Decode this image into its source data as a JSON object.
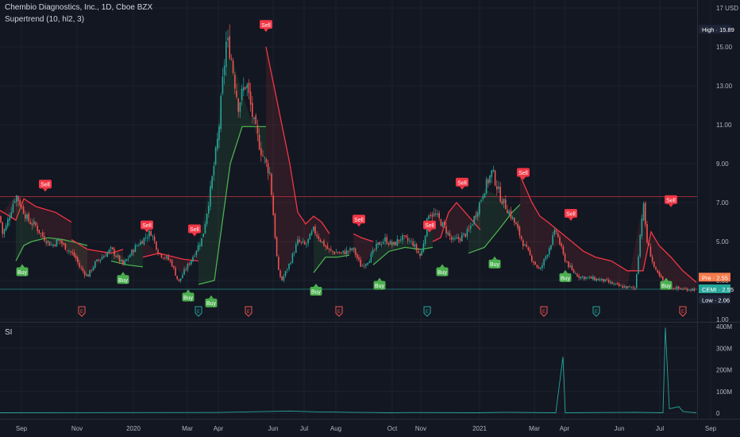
{
  "header": {
    "symbol_line": "Chembio Diagnostics, Inc., 1D, Cboe BZX",
    "indicator_line": "Supertrend (10, hl2, 3)"
  },
  "si_panel": {
    "title": "SI"
  },
  "colors": {
    "background": "#131722",
    "up_candle": "#26a69a",
    "down_candle": "#ef5350",
    "supertrend_up": "#4caf50",
    "supertrend_down": "#f23645",
    "grid": "#1e222d",
    "axis_text": "#b2b5be"
  },
  "tags": {
    "high": "High · 15.89",
    "pre": "Pre · 2.55",
    "cemi": "CEMI · 2.55",
    "low": "Low · 2.06"
  },
  "chart_data": [
    {
      "type": "candlestick",
      "title": "Chembio Diagnostics, Inc., 1D, Cboe BZX",
      "y_unit": "USD",
      "y_ticks": [
        "1.00",
        "3.00",
        "5.00",
        "7.00",
        "9.00",
        "11.00",
        "13.00",
        "15.00",
        "17 USD"
      ],
      "y_tick_values": [
        1,
        3,
        5,
        7,
        9,
        11,
        13,
        15,
        17
      ],
      "ylim": [
        1,
        17
      ],
      "x_ticks": [
        "Sep",
        "Nov",
        "2020",
        "Mar",
        "Apr",
        "Jun",
        "Jul",
        "Aug",
        "Oct",
        "Nov",
        "2021",
        "Mar",
        "Apr",
        "Jun",
        "Jul",
        "Sep"
      ],
      "price_path": [
        [
          0,
          6.3
        ],
        [
          3,
          5.4
        ],
        [
          8,
          5.8
        ],
        [
          15,
          6.8
        ],
        [
          20,
          7.4
        ],
        [
          25,
          7.0
        ],
        [
          35,
          6.1
        ],
        [
          45,
          5.8
        ],
        [
          55,
          5.2
        ],
        [
          65,
          4.8
        ],
        [
          75,
          5.1
        ],
        [
          80,
          4.8
        ],
        [
          95,
          4.2
        ],
        [
          100,
          3.7
        ],
        [
          110,
          3.2
        ],
        [
          120,
          3.9
        ],
        [
          140,
          4.6
        ],
        [
          155,
          3.8
        ],
        [
          170,
          4.7
        ],
        [
          190,
          5.5
        ],
        [
          200,
          4.4
        ],
        [
          215,
          4.0
        ],
        [
          225,
          2.9
        ],
        [
          231,
          3.4
        ],
        [
          240,
          4.0
        ],
        [
          255,
          5.2
        ],
        [
          265,
          7.6
        ],
        [
          275,
          10.5
        ],
        [
          280,
          13.0
        ],
        [
          285,
          15.3
        ],
        [
          290,
          14.8
        ],
        [
          300,
          12.0
        ],
        [
          310,
          13.2
        ],
        [
          320,
          11.0
        ],
        [
          330,
          9.5
        ],
        [
          340,
          8.5
        ],
        [
          350,
          3.5
        ],
        [
          355,
          3.0
        ],
        [
          365,
          3.9
        ],
        [
          375,
          5.0
        ],
        [
          385,
          4.8
        ],
        [
          395,
          5.6
        ],
        [
          405,
          5.0
        ],
        [
          415,
          4.5
        ],
        [
          430,
          4.4
        ],
        [
          445,
          4.6
        ],
        [
          455,
          3.7
        ],
        [
          465,
          4.1
        ],
        [
          475,
          4.8
        ],
        [
          485,
          5.1
        ],
        [
          495,
          4.8
        ],
        [
          505,
          5.2
        ],
        [
          520,
          4.9
        ],
        [
          530,
          4.2
        ],
        [
          540,
          6.5
        ],
        [
          550,
          6.3
        ],
        [
          560,
          5.7
        ],
        [
          570,
          5.0
        ],
        [
          580,
          5.2
        ],
        [
          590,
          5.5
        ],
        [
          600,
          6.5
        ],
        [
          610,
          7.7
        ],
        [
          620,
          8.6
        ],
        [
          630,
          7.3
        ],
        [
          640,
          6.6
        ],
        [
          650,
          5.8
        ],
        [
          660,
          4.8
        ],
        [
          670,
          4.1
        ],
        [
          680,
          3.5
        ],
        [
          690,
          4.5
        ],
        [
          700,
          5.6
        ],
        [
          710,
          4.2
        ],
        [
          720,
          3.5
        ],
        [
          730,
          3.2
        ],
        [
          745,
          3.1
        ],
        [
          760,
          3.0
        ],
        [
          780,
          2.7
        ],
        [
          800,
          2.6
        ],
        [
          810,
          7.0
        ],
        [
          815,
          5.0
        ],
        [
          825,
          3.5
        ],
        [
          840,
          2.7
        ],
        [
          860,
          2.55
        ],
        [
          877,
          2.55
        ]
      ],
      "supertrend": [
        {
          "direction": "down",
          "points": [
            [
              0,
              6.6
            ],
            [
              20,
              6.1
            ],
            [
              30,
              7.2
            ],
            [
              45,
              6.8
            ],
            [
              70,
              6.5
            ],
            [
              90,
              6.0
            ]
          ]
        },
        {
          "direction": "up",
          "points": [
            [
              20,
              4.0
            ],
            [
              30,
              4.8
            ],
            [
              40,
              5.0
            ],
            [
              60,
              5.2
            ],
            [
              80,
              5.1
            ],
            [
              90,
              5.0
            ],
            [
              110,
              4.8
            ]
          ]
        },
        {
          "direction": "down",
          "points": [
            [
              90,
              5.1
            ],
            [
              110,
              4.6
            ],
            [
              140,
              4.4
            ],
            [
              155,
              4.6
            ]
          ]
        },
        {
          "direction": "up",
          "points": [
            [
              140,
              4.0
            ],
            [
              160,
              3.8
            ],
            [
              180,
              3.7
            ]
          ]
        },
        {
          "direction": "down",
          "points": [
            [
              180,
              4.2
            ],
            [
              200,
              4.4
            ],
            [
              230,
              4.1
            ],
            [
              250,
              4.0
            ]
          ]
        },
        {
          "direction": "up",
          "points": [
            [
              250,
              2.8
            ],
            [
              270,
              3.0
            ],
            [
              280,
              6.0
            ],
            [
              290,
              9.0
            ],
            [
              305,
              10.9
            ],
            [
              335,
              10.9
            ]
          ]
        },
        {
          "direction": "down",
          "points": [
            [
              335,
              15.0
            ],
            [
              345,
              13.0
            ],
            [
              355,
              11.0
            ],
            [
              365,
              9.0
            ],
            [
              375,
              6.5
            ],
            [
              385,
              5.9
            ],
            [
              395,
              6.3
            ],
            [
              405,
              6.0
            ],
            [
              415,
              5.4
            ]
          ]
        },
        {
          "direction": "up",
          "points": [
            [
              395,
              3.4
            ],
            [
              410,
              4.2
            ],
            [
              425,
              4.2
            ],
            [
              440,
              4.3
            ]
          ]
        },
        {
          "direction": "down",
          "points": [
            [
              445,
              5.4
            ],
            [
              455,
              5.2
            ],
            [
              470,
              5.0
            ]
          ]
        },
        {
          "direction": "up",
          "points": [
            [
              470,
              3.8
            ],
            [
              490,
              4.5
            ],
            [
              510,
              4.7
            ],
            [
              530,
              4.6
            ],
            [
              545,
              4.7
            ]
          ]
        },
        {
          "direction": "down",
          "points": [
            [
              545,
              5.0
            ],
            [
              555,
              5.2
            ],
            [
              565,
              6.5
            ],
            [
              575,
              7.0
            ],
            [
              590,
              6.3
            ],
            [
              605,
              5.6
            ]
          ]
        },
        {
          "direction": "up",
          "points": [
            [
              590,
              4.4
            ],
            [
              610,
              4.7
            ],
            [
              630,
              5.7
            ],
            [
              645,
              6.5
            ],
            [
              655,
              6.9
            ]
          ]
        },
        {
          "direction": "down",
          "points": [
            [
              655,
              8.4
            ],
            [
              670,
              7.0
            ],
            [
              680,
              6.3
            ],
            [
              690,
              6.0
            ],
            [
              705,
              5.5
            ],
            [
              720,
              5.0
            ],
            [
              735,
              4.5
            ],
            [
              750,
              4.2
            ],
            [
              770,
              4.0
            ],
            [
              790,
              3.5
            ],
            [
              810,
              3.5
            ],
            [
              820,
              5.5
            ],
            [
              830,
              4.8
            ],
            [
              845,
              4.2
            ],
            [
              860,
              3.5
            ],
            [
              877,
              2.9
            ]
          ]
        }
      ],
      "signals": [
        {
          "label": "Sell",
          "x": 57,
          "price": 7.4
        },
        {
          "label": "Buy",
          "x": 28,
          "price": 4.0
        },
        {
          "label": "Buy",
          "x": 155,
          "price": 3.6
        },
        {
          "label": "Sell",
          "x": 185,
          "price": 5.3
        },
        {
          "label": "Buy",
          "x": 237,
          "price": 2.7
        },
        {
          "label": "Sell",
          "x": 245,
          "price": 5.1
        },
        {
          "label": "Buy",
          "x": 266,
          "price": 2.4
        },
        {
          "label": "Sell",
          "x": 335,
          "price": 15.6
        },
        {
          "label": "Buy",
          "x": 398,
          "price": 3.0
        },
        {
          "label": "Sell",
          "x": 452,
          "price": 5.6
        },
        {
          "label": "Buy",
          "x": 478,
          "price": 3.3
        },
        {
          "label": "Sell",
          "x": 541,
          "price": 5.3
        },
        {
          "label": "Buy",
          "x": 557,
          "price": 4.0
        },
        {
          "label": "Sell",
          "x": 582,
          "price": 7.5
        },
        {
          "label": "Buy",
          "x": 623,
          "price": 4.4
        },
        {
          "label": "Sell",
          "x": 659,
          "price": 8.0
        },
        {
          "label": "Buy",
          "x": 712,
          "price": 3.7
        },
        {
          "label": "Sell",
          "x": 719,
          "price": 5.9
        },
        {
          "label": "Buy",
          "x": 839,
          "price": 3.3
        },
        {
          "label": "Sell",
          "x": 845,
          "price": 6.6
        }
      ],
      "earnings_markers": [
        {
          "x": 103
        },
        {
          "x": 250
        },
        {
          "x": 313
        },
        {
          "x": 427
        },
        {
          "x": 538
        },
        {
          "x": 685
        },
        {
          "x": 751
        },
        {
          "x": 860
        }
      ],
      "reference_lines": [
        {
          "price": 7.3,
          "color": "#f23645"
        },
        {
          "price": 2.55,
          "color": "#26a69a"
        }
      ],
      "price_labels": [
        {
          "text": "High · 15.89",
          "price": 15.89,
          "color": "#1e2538"
        },
        {
          "text": "Pre · 2.55",
          "price": 3.15,
          "color": "#f57c4d"
        },
        {
          "text": "CEMI · 2.55",
          "price": 2.55,
          "color": "#26a69a"
        },
        {
          "text": "Low · 2.06",
          "price": 2.0,
          "color": "#1e2538"
        }
      ]
    },
    {
      "type": "line",
      "title": "SI",
      "y_ticks": [
        "0",
        "100M",
        "200M",
        "300M",
        "400M"
      ],
      "y_tick_values": [
        0,
        100,
        200,
        300,
        400
      ],
      "ylim": [
        0,
        400
      ],
      "spikes": [
        [
          0,
          2
        ],
        [
          270,
          3
        ],
        [
          365,
          10
        ],
        [
          380,
          8
        ],
        [
          400,
          6
        ],
        [
          420,
          5
        ],
        [
          440,
          4
        ],
        [
          470,
          3
        ],
        [
          490,
          2
        ],
        [
          520,
          3
        ],
        [
          600,
          2
        ],
        [
          640,
          4
        ],
        [
          700,
          2
        ],
        [
          709,
          260
        ],
        [
          712,
          2
        ],
        [
          760,
          3
        ],
        [
          800,
          4
        ],
        [
          835,
          2
        ],
        [
          838,
          395
        ],
        [
          843,
          20
        ],
        [
          855,
          30
        ],
        [
          860,
          8
        ],
        [
          870,
          4
        ],
        [
          877,
          2
        ]
      ]
    }
  ]
}
